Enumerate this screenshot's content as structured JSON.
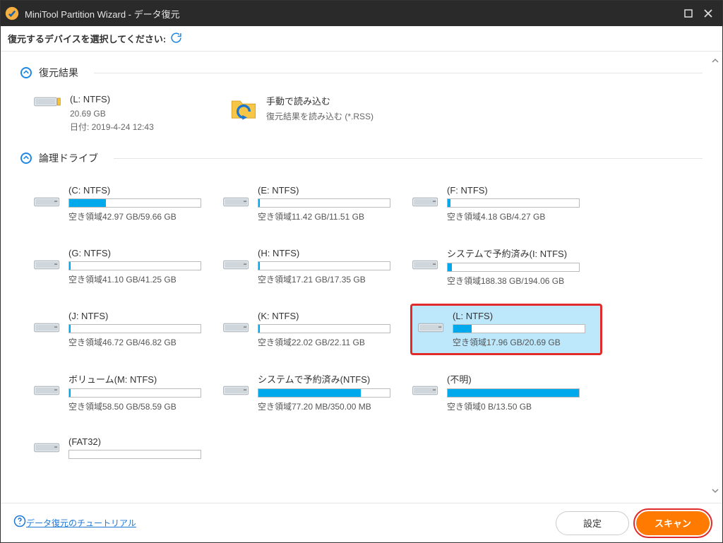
{
  "app_title": "MiniTool Partition Wizard - データ復元",
  "select_label": "復元するデバイスを選択してください:",
  "sections": {
    "restore_result": {
      "title": "復元結果",
      "item": {
        "name": "(L: NTFS)",
        "size": "20.69 GB",
        "date_label": "日付: 2019-4-24 12:43"
      },
      "manual": {
        "title": "手動で読み込む",
        "sub": "復元結果を読み込む (*.RSS)"
      }
    },
    "logical_drives": {
      "title": "論理ドライブ",
      "drives": [
        {
          "name": "(C: NTFS)",
          "space": "空き領域42.97 GB/59.66 GB",
          "fill": 28,
          "selected": false
        },
        {
          "name": "(E: NTFS)",
          "space": "空き領域11.42 GB/11.51 GB",
          "fill": 1,
          "selected": false
        },
        {
          "name": "(F: NTFS)",
          "space": "空き領域4.18 GB/4.27 GB",
          "fill": 2,
          "selected": false
        },
        {
          "name": "(G: NTFS)",
          "space": "空き領域41.10 GB/41.25 GB",
          "fill": 1,
          "selected": false
        },
        {
          "name": "(H: NTFS)",
          "space": "空き領域17.21 GB/17.35 GB",
          "fill": 1,
          "selected": false
        },
        {
          "name": "システムで予約済み(I: NTFS)",
          "space": "空き領域188.38 GB/194.06 GB",
          "fill": 3,
          "selected": false
        },
        {
          "name": "(J: NTFS)",
          "space": "空き領域46.72 GB/46.82 GB",
          "fill": 1,
          "selected": false
        },
        {
          "name": "(K: NTFS)",
          "space": "空き領域22.02 GB/22.11 GB",
          "fill": 1,
          "selected": false
        },
        {
          "name": "(L: NTFS)",
          "space": "空き領域17.96 GB/20.69 GB",
          "fill": 14,
          "selected": true
        },
        {
          "name": "ボリューム(M: NTFS)",
          "space": "空き領域58.50 GB/58.59 GB",
          "fill": 1,
          "selected": false
        },
        {
          "name": "システムで予約済み(NTFS)",
          "space": "空き領域77.20 MB/350.00 MB",
          "fill": 78,
          "selected": false
        },
        {
          "name": "(不明)",
          "space": "空き領域0 B/13.50 GB",
          "fill": 100,
          "selected": false
        },
        {
          "name": "(FAT32)",
          "space": "",
          "fill": 0,
          "selected": false
        }
      ]
    }
  },
  "footer": {
    "help": "データ復元のチュートリアル",
    "settings": "設定",
    "scan": "スキャン"
  }
}
